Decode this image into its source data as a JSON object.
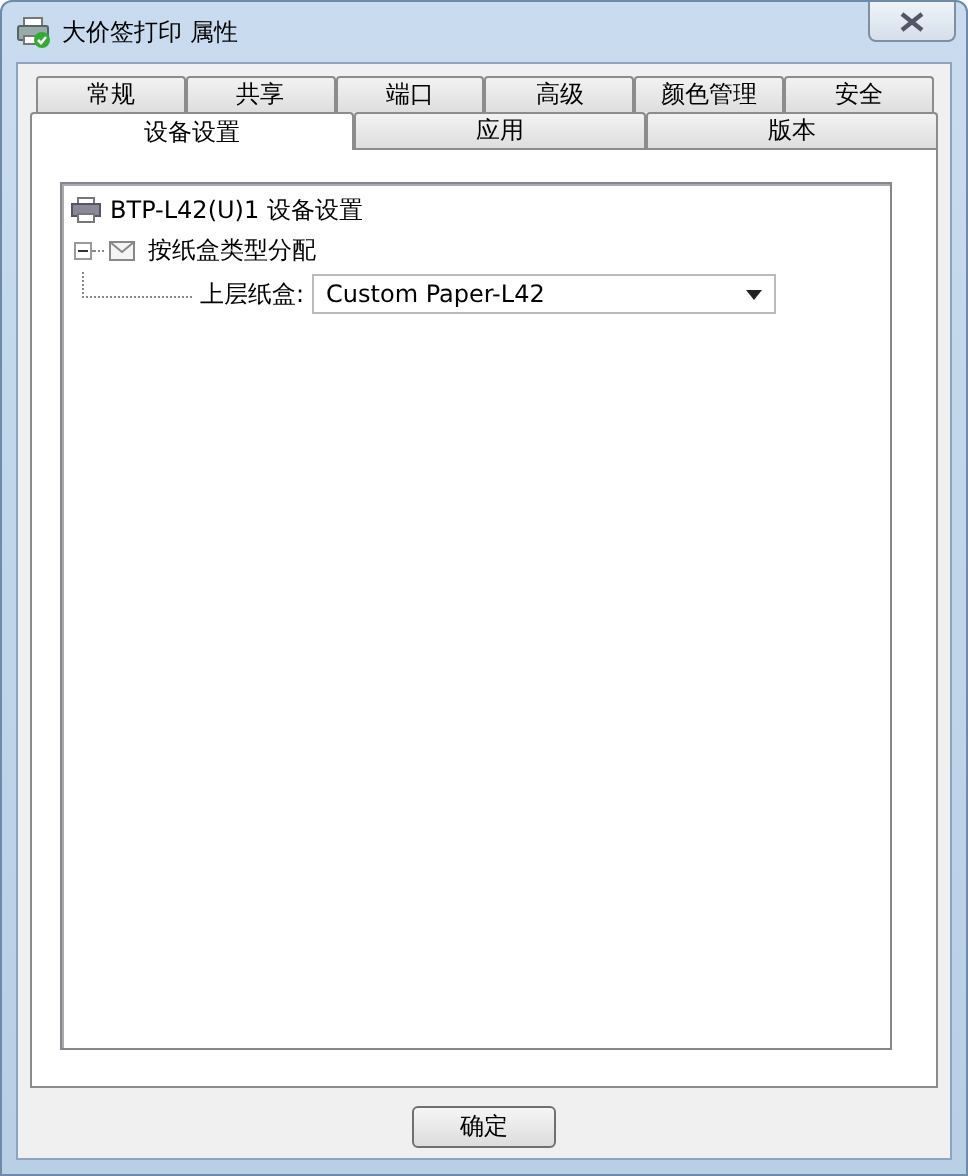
{
  "window": {
    "title": "大价签打印 属性"
  },
  "tab_rows": [
    [
      {
        "label": "常规",
        "selected": false
      },
      {
        "label": "共享",
        "selected": false
      },
      {
        "label": "端口",
        "selected": false
      },
      {
        "label": "高级",
        "selected": false
      },
      {
        "label": "颜色管理",
        "selected": false
      },
      {
        "label": "安全",
        "selected": false
      }
    ],
    [
      {
        "label": "设备设置",
        "selected": true
      },
      {
        "label": "应用",
        "selected": false
      },
      {
        "label": "版本",
        "selected": false
      }
    ]
  ],
  "tree": {
    "label": "BTP-L42(U)1 设备设置",
    "children": [
      {
        "label": "按纸盒类型分配",
        "expanded": true,
        "children": [
          {
            "kind": "dropdown",
            "label": "上层纸盒:",
            "value": "Custom Paper-L42"
          }
        ]
      }
    ]
  },
  "buttons": [
    "确定"
  ]
}
